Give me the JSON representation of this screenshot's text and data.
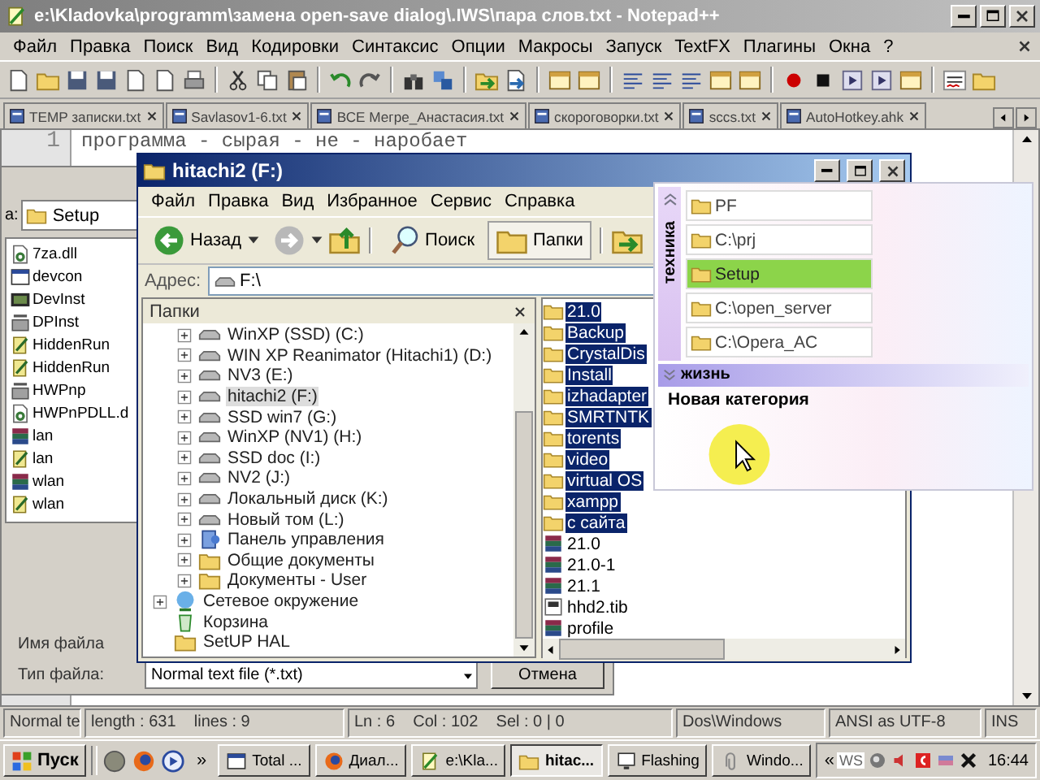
{
  "notepad": {
    "title": "e:\\Kladovka\\programm\\замена open-save dialog\\.IWS\\пара слов.txt - Notepad++",
    "menu": [
      "Файл",
      "Правка",
      "Поиск",
      "Вид",
      "Кодировки",
      "Синтаксис",
      "Опции",
      "Макросы",
      "Запуск",
      "TextFX",
      "Плагины",
      "Окна",
      "?"
    ],
    "tabs": [
      {
        "label": "TEMP записки.txt",
        "selected": false
      },
      {
        "label": "Savlasov1-6.txt",
        "selected": false
      },
      {
        "label": "ВСЕ Мегре_Анастасия.txt",
        "selected": false
      },
      {
        "label": "скороговорки.txt",
        "selected": false
      },
      {
        "label": "sccs.txt",
        "selected": false
      },
      {
        "label": "AutoHotkey.ahk",
        "selected": false
      }
    ],
    "line_number": "1",
    "editor_text": "программа - сырая - не - наробает",
    "status_bar": [
      "Normal te",
      "length : 631    lines : 9",
      "Ln : 6    Col : 102    Sel : 0 | 0",
      "Dos\\Windows",
      "ANSI as UTF-8",
      "INS"
    ]
  },
  "open_dialog": {
    "look_in_label": "а:",
    "folder": "Setup",
    "files": [
      {
        "name": "7za.dll",
        "kind": "dll"
      },
      {
        "name": "devcon",
        "kind": "window"
      },
      {
        "name": "DevInst",
        "kind": "app"
      },
      {
        "name": "DPInst",
        "kind": "setup"
      },
      {
        "name": "HiddenRun",
        "kind": "script"
      },
      {
        "name": "HiddenRun",
        "kind": "script"
      },
      {
        "name": "HWPnp",
        "kind": "setup"
      },
      {
        "name": "HWPnPDLL.d",
        "kind": "dll"
      },
      {
        "name": "lan",
        "kind": "archive"
      },
      {
        "name": "lan",
        "kind": "script"
      },
      {
        "name": "wlan",
        "kind": "archive"
      },
      {
        "name": "wlan",
        "kind": "script"
      }
    ],
    "filename_label": "Имя файла",
    "filetype_label": "Тип файла:",
    "filetype_value": "Normal text file (*.txt)",
    "cancel": "Отмена"
  },
  "explorer": {
    "title": "hitachi2 (F:)",
    "menu": [
      "Файл",
      "Правка",
      "Вид",
      "Избранное",
      "Сервис",
      "Справка"
    ],
    "toolbar": [
      {
        "label": "Назад",
        "kind": "back",
        "selected": false
      },
      {
        "label": "Поиск",
        "kind": "search",
        "selected": false
      },
      {
        "label": "Папки",
        "kind": "folders",
        "selected": true
      }
    ],
    "address_label": "Адрес:",
    "address": "F:\\",
    "pane_title": "Папки",
    "computer_items": [
      {
        "label": "WinXP (SSD) (C:)",
        "kind": "drive",
        "has_children": true,
        "expanded": false,
        "selected": false
      },
      {
        "label": "WIN XP Reanimator (Hitachi1) (D:)",
        "kind": "drive",
        "has_children": true,
        "expanded": false,
        "selected": false
      },
      {
        "label": "NV3 (E:)",
        "kind": "drive",
        "has_children": true,
        "expanded": false,
        "selected": false
      },
      {
        "label": "hitachi2 (F:)",
        "kind": "drive",
        "has_children": true,
        "expanded": false,
        "selected": true
      },
      {
        "label": "SSD win7 (G:)",
        "kind": "drive",
        "has_children": true,
        "expanded": false,
        "selected": false
      },
      {
        "label": "WinXP (NV1) (H:)",
        "kind": "drive",
        "has_children": true,
        "expanded": false,
        "selected": false
      },
      {
        "label": "SSD  doc (I:)",
        "kind": "drive",
        "has_children": true,
        "expanded": false,
        "selected": false
      },
      {
        "label": "NV2 (J:)",
        "kind": "drive",
        "has_children": true,
        "expanded": false,
        "selected": false
      },
      {
        "label": "Локальный диск (K:)",
        "kind": "drive",
        "has_children": true,
        "expanded": false,
        "selected": false
      },
      {
        "label": "Новый том (L:)",
        "kind": "drive",
        "has_children": true,
        "expanded": false,
        "selected": false
      },
      {
        "label": "Панель управления",
        "kind": "cpanel",
        "has_children": true,
        "expanded": false,
        "selected": false
      },
      {
        "label": "Общие документы",
        "kind": "folder",
        "has_children": true,
        "expanded": false,
        "selected": false
      },
      {
        "label": "Документы - User",
        "kind": "folder",
        "has_children": true,
        "expanded": false,
        "selected": false
      }
    ],
    "tree_items": [
      {
        "label": "Сетевое окружение",
        "kind": "network",
        "has_children": true,
        "expanded": false,
        "selected": false
      },
      {
        "label": "Корзина",
        "kind": "recycle",
        "has_children": false,
        "expanded": false,
        "selected": false
      },
      {
        "label": "SetUP HAL",
        "kind": "folder",
        "has_children": false,
        "expanded": false,
        "selected": false
      }
    ],
    "files": [
      {
        "name": "21.0",
        "kind": "folder",
        "selected": true
      },
      {
        "name": "Backup",
        "kind": "folder",
        "selected": true
      },
      {
        "name": "CrystalDis",
        "kind": "folder",
        "selected": true
      },
      {
        "name": "Install",
        "kind": "folder",
        "selected": true
      },
      {
        "name": "izhadapter",
        "kind": "folder",
        "selected": true
      },
      {
        "name": "SMRTNTK",
        "kind": "folder",
        "selected": true
      },
      {
        "name": "torents",
        "kind": "folder",
        "selected": true
      },
      {
        "name": "video",
        "kind": "folder",
        "selected": true
      },
      {
        "name": "virtual OS",
        "kind": "folder",
        "selected": true
      },
      {
        "name": "xampp",
        "kind": "folder",
        "selected": true
      },
      {
        "name": "с сайта",
        "kind": "folder",
        "selected": true
      },
      {
        "name": "21.0",
        "kind": "archive",
        "selected": false
      },
      {
        "name": "21.0-1",
        "kind": "archive",
        "selected": false
      },
      {
        "name": "21.1",
        "kind": "archive",
        "selected": false
      },
      {
        "name": "hhd2.tib",
        "kind": "image",
        "selected": false
      },
      {
        "name": "profile",
        "kind": "archive",
        "selected": false
      }
    ]
  },
  "launcher": {
    "categories": [
      {
        "label": "техника",
        "expanded": true,
        "items": [
          {
            "label": "PF",
            "selected": false
          },
          {
            "label": "C:\\prj",
            "selected": false
          },
          {
            "label": "Setup",
            "selected": true
          },
          {
            "label": "C:\\open_server",
            "selected": false
          },
          {
            "label": "C:\\Opera_AC",
            "selected": false
          }
        ]
      },
      {
        "label": "жизнь",
        "expanded": false
      }
    ],
    "new_category": "Новая категория"
  },
  "taskbar": {
    "start": "Пуск",
    "more": "»",
    "tasks": [
      {
        "label": "Total ...",
        "kind": "window",
        "selected": false
      },
      {
        "label": "Диал...",
        "kind": "browser",
        "selected": false
      },
      {
        "label": "e:\\Kla...",
        "kind": "notepad",
        "selected": false
      },
      {
        "label": "hitac...",
        "kind": "folder",
        "selected": true
      },
      {
        "label": "Flashing",
        "kind": "monitor",
        "selected": false
      },
      {
        "label": "Windo...",
        "kind": "clip",
        "selected": false
      }
    ],
    "tray_toggle": "«",
    "tray_label": "WS",
    "clock": "16:44"
  }
}
